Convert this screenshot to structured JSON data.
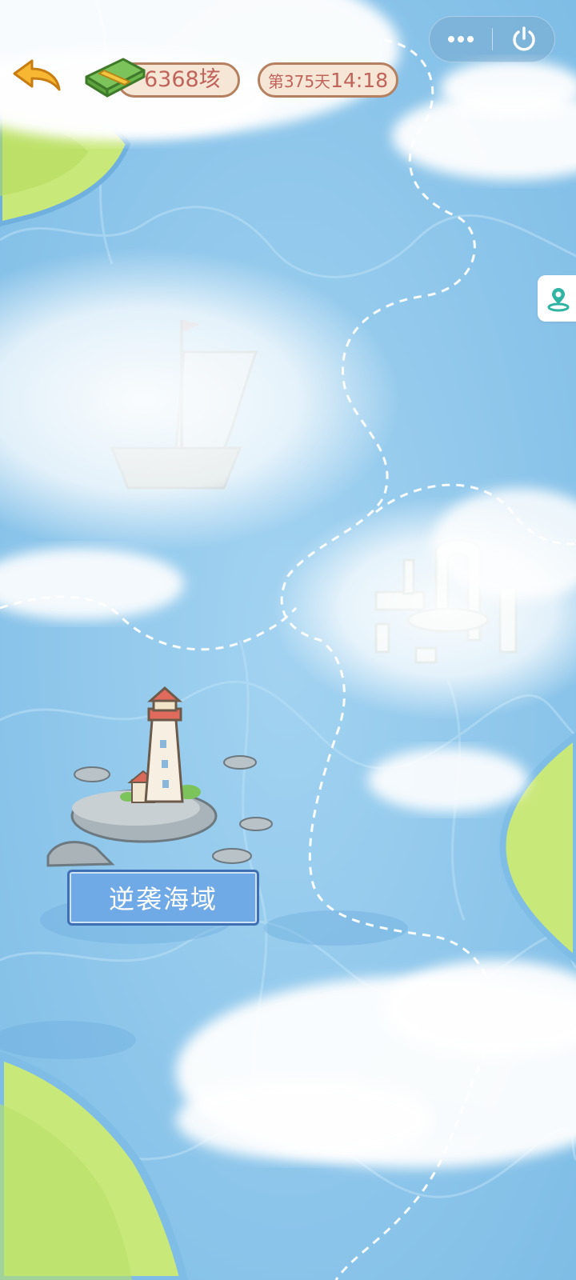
{
  "header": {
    "currency_amount": "6368",
    "currency_unit": "垓",
    "day_label": "第375天",
    "clock": "14:18"
  },
  "capsule": {
    "more_icon": "more-dots-icon",
    "power_icon": "power-icon"
  },
  "side_button": {
    "icon": "map-pin-icon"
  },
  "map": {
    "location_label": "逆袭海域",
    "colors": {
      "sea": "#8cc7ec",
      "sea_light": "#a9d6f2",
      "land": "#c9e87a",
      "label_bg": "#6fa9e6",
      "label_border": "#3f6fb5",
      "pill_text": "#c0635a",
      "pill_bg": "#f5e6d6"
    }
  }
}
